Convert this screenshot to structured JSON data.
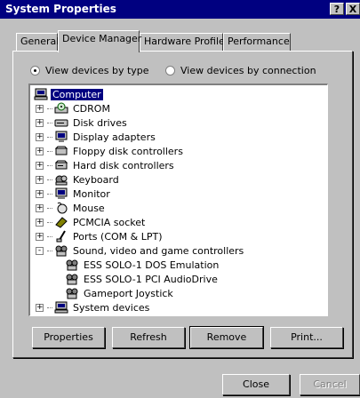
{
  "window": {
    "title": "System Properties",
    "help_button": "?",
    "close_button": "X"
  },
  "tabs": [
    {
      "label": "General",
      "active": false
    },
    {
      "label": "Device Manager",
      "active": true
    },
    {
      "label": "Hardware Profiles",
      "active": false
    },
    {
      "label": "Performance",
      "active": false
    }
  ],
  "view_options": {
    "by_type": {
      "label": "View devices by type",
      "selected": true
    },
    "by_connection": {
      "label": "View devices by connection",
      "selected": false
    }
  },
  "tree": {
    "root": {
      "label": "Computer",
      "icon": "computer-icon",
      "selected": true
    },
    "items": [
      {
        "label": "CDROM",
        "icon": "cdrom-icon",
        "expander": "+"
      },
      {
        "label": "Disk drives",
        "icon": "disk-drive-icon",
        "expander": "+"
      },
      {
        "label": "Display adapters",
        "icon": "display-adapter-icon",
        "expander": "+"
      },
      {
        "label": "Floppy disk controllers",
        "icon": "floppy-controller-icon",
        "expander": "+"
      },
      {
        "label": "Hard disk controllers",
        "icon": "hard-disk-controller-icon",
        "expander": "+"
      },
      {
        "label": "Keyboard",
        "icon": "keyboard-icon",
        "expander": "+"
      },
      {
        "label": "Monitor",
        "icon": "monitor-icon",
        "expander": "+"
      },
      {
        "label": "Mouse",
        "icon": "mouse-icon",
        "expander": "+"
      },
      {
        "label": "PCMCIA socket",
        "icon": "pcmcia-icon",
        "expander": "+"
      },
      {
        "label": "Ports (COM & LPT)",
        "icon": "ports-icon",
        "expander": "+"
      },
      {
        "label": "Sound, video and game controllers",
        "icon": "sound-icon",
        "expander": "-"
      },
      {
        "label": "ESS SOLO-1 DOS Emulation",
        "icon": "sound-device-icon",
        "child": true
      },
      {
        "label": "ESS SOLO-1 PCI AudioDrive",
        "icon": "sound-device-icon",
        "child": true
      },
      {
        "label": "Gameport Joystick",
        "icon": "sound-device-icon",
        "child": true
      },
      {
        "label": "System devices",
        "icon": "system-devices-icon",
        "expander": "+"
      }
    ]
  },
  "buttons": {
    "properties": "Properties",
    "refresh": "Refresh",
    "remove": "Remove",
    "print": "Print...",
    "close": "Close",
    "cancel": "Cancel"
  },
  "colors": {
    "titlebar": "#000080",
    "face": "#c0c0c0",
    "selection": "#000080"
  }
}
